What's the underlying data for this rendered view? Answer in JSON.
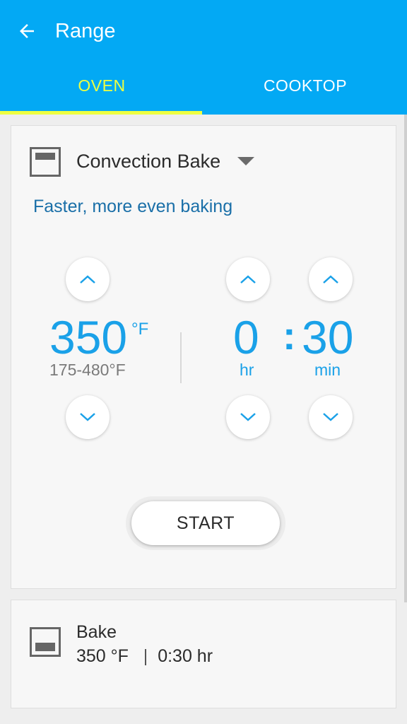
{
  "app_bar": {
    "title": "Range",
    "back_icon": "arrow-left-icon",
    "background": "#03a9f4"
  },
  "tabs": [
    {
      "label": "OVEN",
      "selected": true
    },
    {
      "label": "COOKTOP",
      "selected": false
    }
  ],
  "colors": {
    "accent": "#1aa1e8",
    "tab_selected": "#eeff41",
    "subtitle": "#1a6fa8"
  },
  "oven": {
    "mode_icon": "oven-icon",
    "mode": "Convection Bake",
    "mode_dropdown_icon": "caret-down-icon",
    "description": "Faster, more even baking",
    "temperature": {
      "value": "350",
      "unit": "°F",
      "range": "175-480°F"
    },
    "timer": {
      "hours": "0",
      "separator": ":",
      "minutes": "30",
      "hours_unit": "hr",
      "minutes_unit": "min"
    },
    "start_label": "START"
  },
  "preset": {
    "icon": "oven-icon",
    "name": "Bake",
    "temperature": "350 °F",
    "separator": "|",
    "time": "0:30 hr"
  }
}
